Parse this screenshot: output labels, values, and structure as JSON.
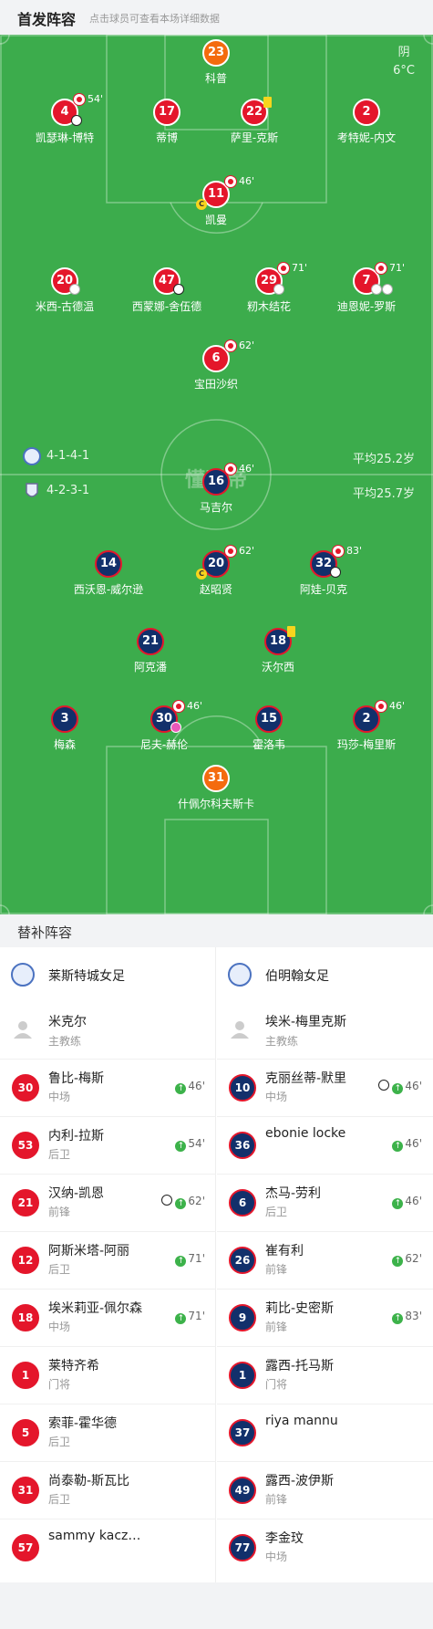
{
  "header": {
    "title": "首发阵容",
    "hint": "点击球员可查看本场详细数据"
  },
  "weather": {
    "condition": "阴",
    "temp": "6°C"
  },
  "watermark": "懂球帝",
  "home_team": {
    "formation": "4-1-4-1",
    "avg_age": "平均25.2岁"
  },
  "away_team": {
    "formation": "4-2-3-1",
    "avg_age": "平均25.7岁"
  },
  "home_players": [
    {
      "num": "23",
      "name": "科普",
      "kit": "orange"
    },
    {
      "num": "4",
      "name": "凯瑟琳-博特",
      "kit": "red",
      "sub": "54'",
      "goal": true
    },
    {
      "num": "17",
      "name": "蒂博",
      "kit": "red"
    },
    {
      "num": "22",
      "name": "萨里-克斯",
      "kit": "red",
      "yellow": true
    },
    {
      "num": "2",
      "name": "考特妮-内文",
      "kit": "red"
    },
    {
      "num": "11",
      "name": "凯曼",
      "kit": "red",
      "sub": "46'",
      "captain": true
    },
    {
      "num": "20",
      "name": "米西-古德温",
      "kit": "red",
      "shoe": true
    },
    {
      "num": "47",
      "name": "西蒙娜-舍伍德",
      "kit": "red",
      "goal": true
    },
    {
      "num": "29",
      "name": "籾木结花",
      "kit": "red",
      "sub": "71'",
      "shoe": true
    },
    {
      "num": "7",
      "name": "迪恩妮-罗斯",
      "kit": "red",
      "sub": "71'",
      "shoe2": true
    },
    {
      "num": "6",
      "name": "宝田沙织",
      "kit": "red",
      "sub": "62'"
    }
  ],
  "away_players": [
    {
      "num": "16",
      "name": "马吉尔",
      "kit": "blue",
      "sub": "46'"
    },
    {
      "num": "14",
      "name": "西沃恩-威尔逊",
      "kit": "blue"
    },
    {
      "num": "20",
      "name": "赵昭贤",
      "kit": "blue",
      "sub": "62'",
      "captain": true
    },
    {
      "num": "32",
      "name": "阿娃-贝克",
      "kit": "blue",
      "sub": "83'",
      "goal": true
    },
    {
      "num": "21",
      "name": "阿克潘",
      "kit": "blue"
    },
    {
      "num": "18",
      "name": "沃尔西",
      "kit": "blue",
      "yellow": true
    },
    {
      "num": "3",
      "name": "梅森",
      "kit": "blue"
    },
    {
      "num": "30",
      "name": "尼夫-赫伦",
      "kit": "blue",
      "sub": "46'",
      "pink": true
    },
    {
      "num": "15",
      "name": "霍洛韦",
      "kit": "blue"
    },
    {
      "num": "2",
      "name": "玛莎-梅里斯",
      "kit": "blue",
      "sub": "46'"
    },
    {
      "num": "31",
      "name": "什佩尔科夫斯卡",
      "kit": "orange"
    }
  ],
  "subs_section": {
    "title": "替补阵容"
  },
  "left": {
    "team": "莱斯特城女足",
    "coach": {
      "name": "米克尔",
      "role": "主教练"
    },
    "players": [
      {
        "num": "30",
        "name": "鲁比-梅斯",
        "pos": "中场",
        "time": "46'"
      },
      {
        "num": "53",
        "name": "内利-拉斯",
        "pos": "后卫",
        "time": "54'"
      },
      {
        "num": "21",
        "name": "汉纳-凯恩",
        "pos": "前锋",
        "time": "62'",
        "goal": true
      },
      {
        "num": "12",
        "name": "阿斯米塔-阿丽",
        "pos": "后卫",
        "time": "71'"
      },
      {
        "num": "18",
        "name": "埃米莉亚-佩尔森",
        "pos": "中场",
        "time": "71'"
      },
      {
        "num": "1",
        "name": "莱特齐希",
        "pos": "门将",
        "time": ""
      },
      {
        "num": "5",
        "name": "索菲-霍华德",
        "pos": "后卫",
        "time": ""
      },
      {
        "num": "31",
        "name": "尚泰勒-斯瓦比",
        "pos": "后卫",
        "time": ""
      },
      {
        "num": "57",
        "name": "sammy kaczmarek",
        "pos": "",
        "time": ""
      }
    ]
  },
  "right": {
    "team": "伯明翰女足",
    "coach": {
      "name": "埃米-梅里克斯",
      "role": "主教练"
    },
    "players": [
      {
        "num": "10",
        "name": "克丽丝蒂-默里",
        "pos": "中场",
        "time": "46'",
        "goal": true
      },
      {
        "num": "36",
        "name": "ebonie locke",
        "pos": "",
        "time": "46'"
      },
      {
        "num": "6",
        "name": "杰马-劳利",
        "pos": "后卫",
        "time": "46'"
      },
      {
        "num": "26",
        "name": "崔有利",
        "pos": "前锋",
        "time": "62'"
      },
      {
        "num": "9",
        "name": "莉比-史密斯",
        "pos": "前锋",
        "time": "83'"
      },
      {
        "num": "1",
        "name": "露西-托马斯",
        "pos": "门将",
        "time": ""
      },
      {
        "num": "37",
        "name": "riya mannu",
        "pos": "",
        "time": ""
      },
      {
        "num": "49",
        "name": "露西-波伊斯",
        "pos": "前锋",
        "time": ""
      },
      {
        "num": "77",
        "name": "李金玟",
        "pos": "中场",
        "time": ""
      }
    ]
  }
}
